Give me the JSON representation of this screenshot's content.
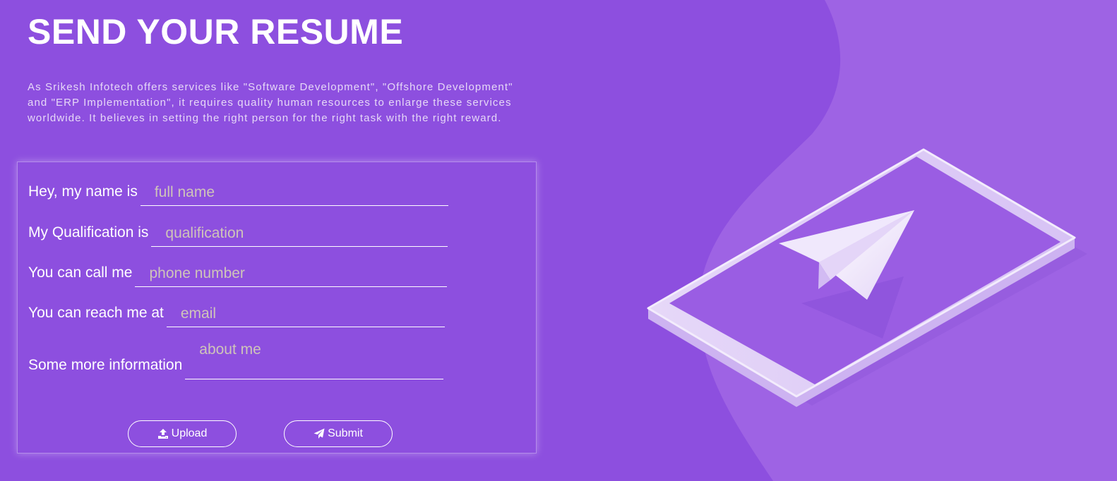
{
  "page": {
    "title": "SEND YOUR RESUME",
    "intro": "As Srikesh Infotech offers services like \"Software Development\", \"Offshore Development\" and \"ERP Implementation\", it requires quality human resources to enlarge these services worldwide. It believes in setting the right person for the right task with the right reward."
  },
  "form": {
    "name": {
      "label": "Hey, my name is",
      "placeholder": "full name"
    },
    "qualification": {
      "label": "My Qualification is",
      "placeholder": "qualification"
    },
    "phone": {
      "label": "You can call me",
      "placeholder": "phone number"
    },
    "email": {
      "label": "You can reach me at",
      "placeholder": "email"
    },
    "about": {
      "label": "Some more information",
      "placeholder": "about me"
    },
    "upload_button": {
      "label": "Upload",
      "icon": "upload-icon"
    },
    "submit_button": {
      "label": "Submit",
      "icon": "paper-plane-icon"
    }
  },
  "colors": {
    "background": "#8d4fdf",
    "wave": "#9e63e4",
    "text": "#ffffff",
    "placeholder": "#cfc4b9"
  }
}
